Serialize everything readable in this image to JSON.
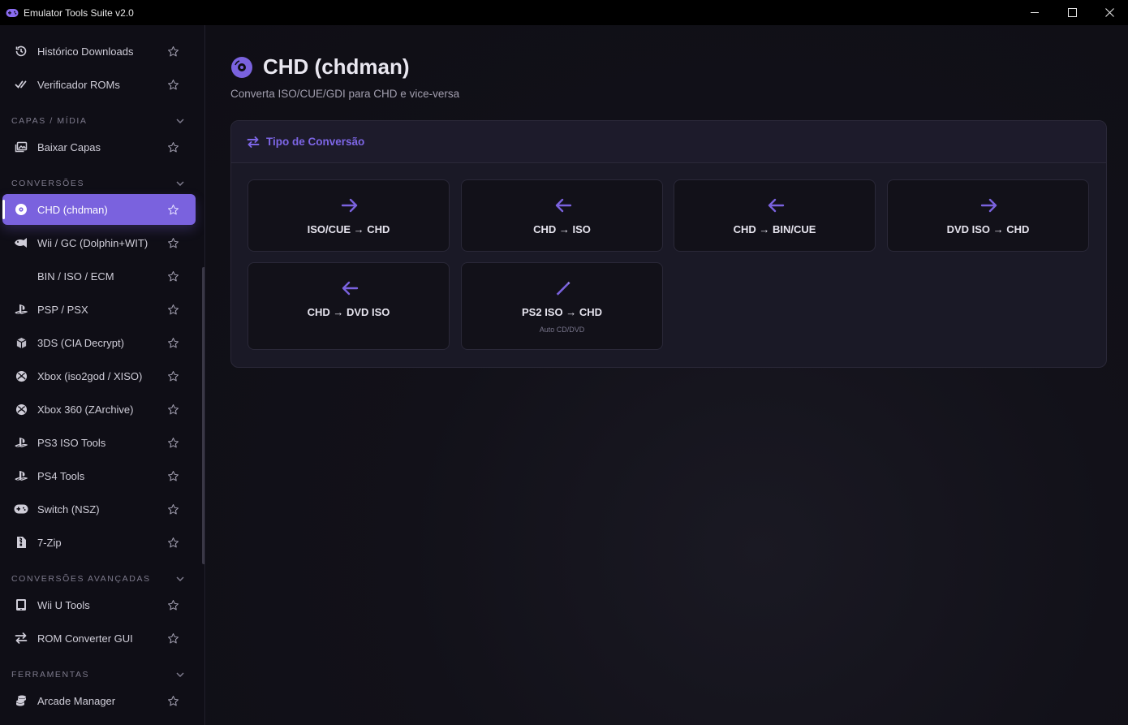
{
  "window": {
    "title": "Emulator Tools Suite v2.0",
    "controls": [
      "minimize",
      "maximize",
      "close"
    ]
  },
  "sidebar": {
    "items_top": [
      {
        "label": "Histórico Downloads",
        "icon": "history-icon"
      },
      {
        "label": "Verificador ROMs",
        "icon": "check-icon"
      }
    ],
    "sections": [
      {
        "title": "CAPAS / MÍDIA",
        "items": [
          {
            "label": "Baixar Capas",
            "icon": "images-icon"
          }
        ]
      },
      {
        "title": "CONVERSÕES",
        "items": [
          {
            "label": "CHD (chdman)",
            "icon": "disc-icon",
            "active": true
          },
          {
            "label": "Wii / GC (Dolphin+WIT)",
            "icon": "fish-icon"
          },
          {
            "label": "BIN / ISO / ECM",
            "icon": ""
          },
          {
            "label": "PSP / PSX",
            "icon": "playstation-icon"
          },
          {
            "label": "3DS (CIA Decrypt)",
            "icon": "cube-icon"
          },
          {
            "label": "Xbox (iso2god / XISO)",
            "icon": "xbox-icon"
          },
          {
            "label": "Xbox 360 (ZArchive)",
            "icon": "xbox-icon"
          },
          {
            "label": "PS3 ISO Tools",
            "icon": "playstation-icon"
          },
          {
            "label": "PS4 Tools",
            "icon": "playstation-icon"
          },
          {
            "label": "Switch (NSZ)",
            "icon": "gamepad-icon"
          },
          {
            "label": "7-Zip",
            "icon": "file-zip-icon"
          }
        ]
      },
      {
        "title": "CONVERSÕES AVANÇADAS",
        "items": [
          {
            "label": "Wii U Tools",
            "icon": "tablet-icon"
          },
          {
            "label": "ROM Converter GUI",
            "icon": "swap-icon"
          }
        ]
      },
      {
        "title": "FERRAMENTAS",
        "items": [
          {
            "label": "Arcade Manager",
            "icon": "coins-icon"
          }
        ]
      }
    ]
  },
  "main": {
    "title": "CHD (chdman)",
    "subtitle": "Converta ISO/CUE/GDI para CHD e vice-versa",
    "panel": {
      "title": "Tipo de Conversão",
      "options": [
        {
          "label": "ISO/CUE → CHD",
          "icon": "arrow-right-icon"
        },
        {
          "label": "CHD → ISO",
          "icon": "arrow-left-icon"
        },
        {
          "label": "CHD → BIN/CUE",
          "icon": "arrow-left-icon"
        },
        {
          "label": "DVD ISO → CHD",
          "icon": "arrow-right-icon"
        },
        {
          "label": "CHD → DVD ISO",
          "icon": "arrow-left-icon"
        },
        {
          "label": "PS2 ISO → CHD",
          "icon": "wand-icon",
          "sublabel": "Auto CD/DVD"
        }
      ]
    }
  },
  "colors": {
    "accent": "#7a62de",
    "accent_text": "#7d66e6",
    "background": "#0d0c13",
    "sidebar_bg": "#0f0e16",
    "panel_bg": "#1a1926",
    "card_bg": "#121119"
  }
}
